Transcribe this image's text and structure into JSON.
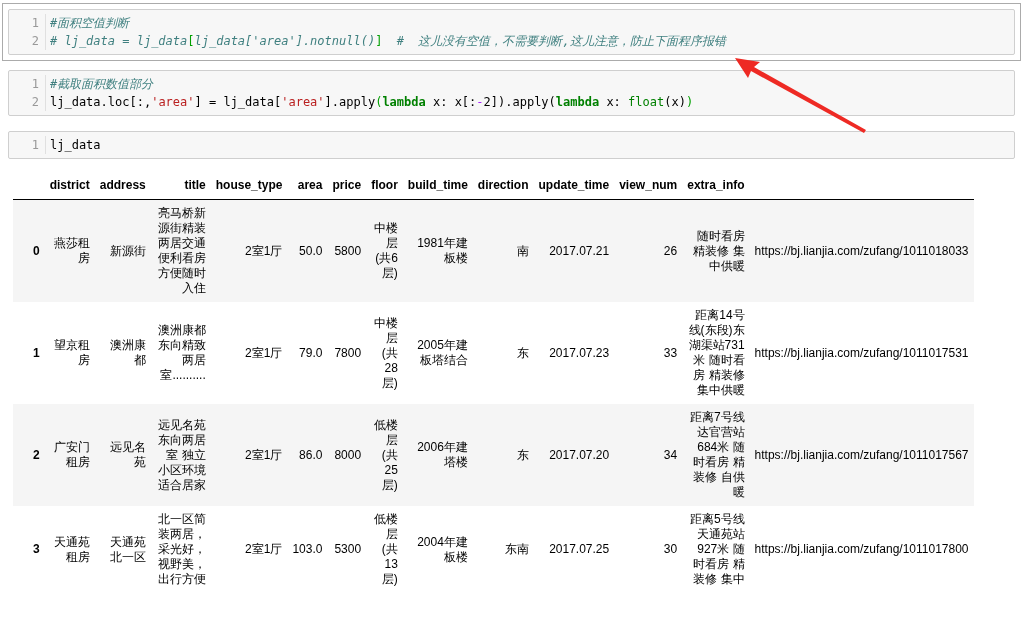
{
  "cells": [
    {
      "selected": true,
      "lines": [
        {
          "number": "1",
          "tokens": [
            {
              "kind": "comment",
              "text": "#面积空值判断"
            }
          ]
        },
        {
          "number": "2",
          "tokens": [
            {
              "kind": "comment",
              "text": "# lj_data = lj_data"
            },
            {
              "kind": "bracket",
              "text": "["
            },
            {
              "kind": "comment",
              "text": "lj_data['area'].notnull()"
            },
            {
              "kind": "bracket",
              "text": "]"
            },
            {
              "kind": "comment",
              "text": "  #  这儿没有空值，不需要判断,这儿注意，防止下面程序报错"
            }
          ]
        }
      ]
    },
    {
      "selected": false,
      "lines": [
        {
          "number": "1",
          "tokens": [
            {
              "kind": "comment",
              "text": "#截取面积数值部分"
            }
          ]
        },
        {
          "number": "2",
          "tokens": [
            {
              "kind": "plain",
              "text": "lj_data.loc[:,"
            },
            {
              "kind": "string",
              "text": "'area'"
            },
            {
              "kind": "plain",
              "text": "] = lj_data["
            },
            {
              "kind": "string",
              "text": "'area'"
            },
            {
              "kind": "plain",
              "text": "].apply"
            },
            {
              "kind": "bracket",
              "text": "("
            },
            {
              "kind": "keyword",
              "text": "lambda"
            },
            {
              "kind": "plain",
              "text": " x: x[:"
            },
            {
              "kind": "operator",
              "text": "-"
            },
            {
              "kind": "plain",
              "text": "2]).apply("
            },
            {
              "kind": "keyword",
              "text": "lambda"
            },
            {
              "kind": "plain",
              "text": " x: "
            },
            {
              "kind": "builtin",
              "text": "float"
            },
            {
              "kind": "plain",
              "text": "(x)"
            },
            {
              "kind": "bracket",
              "text": ")"
            }
          ]
        }
      ]
    },
    {
      "selected": false,
      "lines": [
        {
          "number": "1",
          "tokens": [
            {
              "kind": "plain",
              "text": "lj_data"
            }
          ]
        }
      ]
    }
  ],
  "table": {
    "columns": [
      "district",
      "address",
      "title",
      "house_type",
      "area",
      "price",
      "floor",
      "build_time",
      "direction",
      "update_time",
      "view_num",
      "extra_info"
    ],
    "rows": [
      {
        "index": "0",
        "cells": [
          "燕莎租房",
          "新源街",
          "亮马桥新源街精装两居交通便利看房方便随时入住",
          "2室1厅",
          "50.0",
          "5800",
          "中楼层(共6层)",
          "1981年建板楼",
          "南",
          "2017.07.21",
          "26",
          "随时看房精装修 集中供暖",
          "https://bj.lianjia.com/zufang/1011018033"
        ]
      },
      {
        "index": "1",
        "cells": [
          "望京租房",
          "澳洲康都",
          "澳洲康都东向精致两居室..........",
          "2室1厅",
          "79.0",
          "7800",
          "中楼层(共28层)",
          "2005年建板塔结合",
          "东",
          "2017.07.23",
          "33",
          "距离14号线(东段)东湖渠站731米 随时看房 精装修集中供暖",
          "https://bj.lianjia.com/zufang/1011017531"
        ]
      },
      {
        "index": "2",
        "cells": [
          "广安门租房",
          "远见名苑",
          "远见名苑东向两居室 独立小区环境适合居家",
          "2室1厅",
          "86.0",
          "8000",
          "低楼层(共25层)",
          "2006年建塔楼",
          "东",
          "2017.07.20",
          "34",
          "距离7号线达官营站684米 随时看房 精装修 自供暖",
          "https://bj.lianjia.com/zufang/1011017567"
        ]
      },
      {
        "index": "3",
        "cells": [
          "天通苑租房",
          "天通苑北一区",
          "北一区简装两居，采光好，视野美，出行方便",
          "2室1厅",
          "103.0",
          "5300",
          "低楼层(共13层)",
          "2004年建板楼",
          "东南",
          "2017.07.25",
          "30",
          "距离5号线天通苑站927米 随时看房 精装修 集中",
          "https://bj.lianjia.com/zufang/1011017800"
        ]
      }
    ]
  }
}
